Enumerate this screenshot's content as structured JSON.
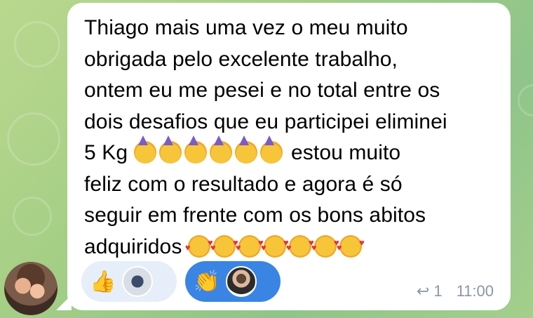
{
  "message": {
    "lines": [
      "Thiago mais uma vez o meu muito",
      "obrigada pelo excelente trabalho,",
      "ontem eu me pesei e no total entre os",
      "dois desafios que eu participei eliminei",
      "5 Kg",
      "estou muito",
      "feliz com o resultado e agora é só",
      "seguir em frente com os bons abitos",
      "adquiridos"
    ],
    "emoji_party": "partying-face-emoji",
    "emoji_love": "smiling-face-with-hearts-emoji"
  },
  "reactions": [
    {
      "emoji": "👍",
      "icon": "thumbs-up-icon"
    },
    {
      "emoji": "👏",
      "icon": "clapping-hands-icon"
    }
  ],
  "meta": {
    "reply_count": "1",
    "time": "11:00"
  },
  "colors": {
    "bubble": "#ffffff",
    "reaction_active": "#3a85e4",
    "reaction_inactive": "#e6eef9",
    "meta_text": "#8c96a3"
  }
}
